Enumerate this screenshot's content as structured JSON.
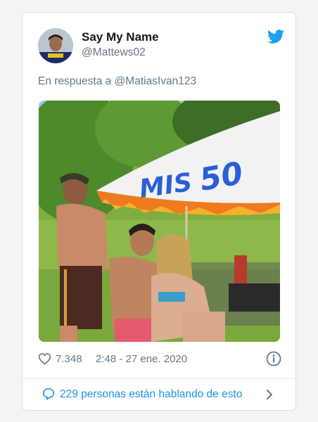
{
  "tweet": {
    "display_name": "Say My Name",
    "handle": "@Mattews02",
    "reply_to": "En respuesta a @MatiasIvan123",
    "photo_sign_text": "MIS 50",
    "likes": "7.348",
    "timestamp": "2:48 - 27 ene. 2020",
    "conversation_label": "229 personas están hablando de esto"
  },
  "icons": {
    "brand": "twitter-bird-icon",
    "like": "heart-icon",
    "info": "info-icon",
    "conversation": "speech-bubble-icon",
    "chevron": "chevron-right-icon"
  },
  "colors": {
    "twitter_blue": "#1da1f2",
    "link_blue": "#1b95e0",
    "secondary_text": "#657786",
    "primary_text": "#14171a"
  }
}
